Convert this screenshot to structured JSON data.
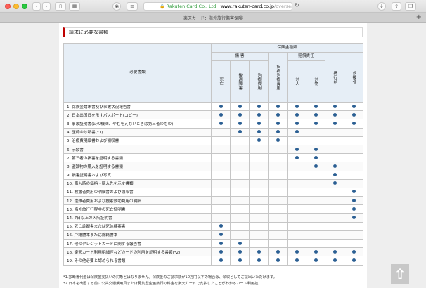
{
  "browser": {
    "address": {
      "org": "Rakuten Card Co., Ltd.",
      "host": "www.rakuten-card.co.jp",
      "path": "/overseas/..."
    },
    "tab_title": "楽天カード：海外旅行傷害保険"
  },
  "section": {
    "title": "請求に必要な書類"
  },
  "table": {
    "header": {
      "documents": "必要書類",
      "insurance_type": "保険金種類",
      "injury": "傷 害",
      "illness": "疾病治療費用",
      "liability": "賠償責任",
      "columns": [
        "死亡",
        "後遺障害",
        "治療費用",
        "疾病治療費用",
        "対人",
        "対物",
        "携行品",
        "救援者"
      ]
    },
    "rows": [
      {
        "label": "1. 保険金請求書及び事故状況報告書",
        "marks": [
          1,
          1,
          1,
          1,
          1,
          1,
          1,
          1
        ]
      },
      {
        "label": "2. 日本出国日を示すパスポート(コピー)",
        "marks": [
          1,
          1,
          1,
          1,
          1,
          1,
          1,
          1
        ]
      },
      {
        "label": "3. 事故証明書(公の機関、やむをえないときは第三者のもの)",
        "marks": [
          1,
          1,
          1,
          1,
          1,
          1,
          1,
          1
        ]
      },
      {
        "label": "4. 医師の診断書(*1)",
        "marks": [
          0,
          1,
          1,
          1,
          1,
          0,
          0,
          0
        ]
      },
      {
        "label": "5. 治療費明細書および領収書",
        "marks": [
          0,
          0,
          1,
          1,
          0,
          0,
          0,
          0
        ]
      },
      {
        "label": "6. 示談書",
        "marks": [
          0,
          0,
          0,
          0,
          1,
          1,
          0,
          0
        ]
      },
      {
        "label": "7. 第三者の損害を証明する書類",
        "marks": [
          0,
          0,
          0,
          0,
          1,
          1,
          0,
          0
        ]
      },
      {
        "label": "8. 盗難物の購入を証明する書類",
        "marks": [
          0,
          0,
          0,
          0,
          0,
          1,
          1,
          0
        ]
      },
      {
        "label": "9. 損害証明書および写真",
        "marks": [
          0,
          0,
          0,
          0,
          0,
          0,
          1,
          0
        ]
      },
      {
        "label": "10. 購入時の価格・購入先を示す書類",
        "marks": [
          0,
          0,
          0,
          0,
          0,
          0,
          1,
          0
        ]
      },
      {
        "label": "11. 救援者費用の明細書および領収書",
        "marks": [
          0,
          0,
          0,
          0,
          0,
          0,
          0,
          1
        ]
      },
      {
        "label": "12. 遭難者費用および捜索救助費用の明細",
        "marks": [
          0,
          0,
          0,
          0,
          0,
          0,
          0,
          1
        ]
      },
      {
        "label": "13. 海外旅行行程中の死亡証明書",
        "marks": [
          0,
          0,
          0,
          0,
          0,
          0,
          0,
          1
        ]
      },
      {
        "label": "14. 7日以上の入院証明書",
        "marks": [
          0,
          0,
          0,
          0,
          0,
          0,
          0,
          1
        ]
      },
      {
        "label": "15. 死亡診断書または死体検案書",
        "marks": [
          1,
          0,
          0,
          0,
          0,
          0,
          0,
          0
        ]
      },
      {
        "label": "16. 戸籍謄本または除籍謄本",
        "marks": [
          1,
          0,
          0,
          0,
          0,
          0,
          0,
          0
        ]
      },
      {
        "label": "17. 他のクレジットカードに関する報告書",
        "marks": [
          1,
          1,
          0,
          0,
          0,
          0,
          0,
          0
        ]
      },
      {
        "label": "18. 楽天カード利用明細控などカードの利用を証明する書類(*2)",
        "marks": [
          1,
          1,
          1,
          1,
          1,
          1,
          1,
          1
        ]
      },
      {
        "label": "19. その他必要と認められる書類",
        "marks": [
          1,
          1,
          1,
          1,
          1,
          1,
          1,
          1
        ]
      }
    ]
  },
  "notes": [
    "*1.診断書代金は保険金支払いの対象とはなりません。保険金のご請求額が10万円以下の場合は、領収としてご提出いただけます。",
    "*2.日本を出国する前に公共交通乗用具または募集型企画旅行の料金を楽天カードで支払したことがわかるカード利用控"
  ],
  "icons": {
    "scroll_top": "up-arrow-icon"
  }
}
